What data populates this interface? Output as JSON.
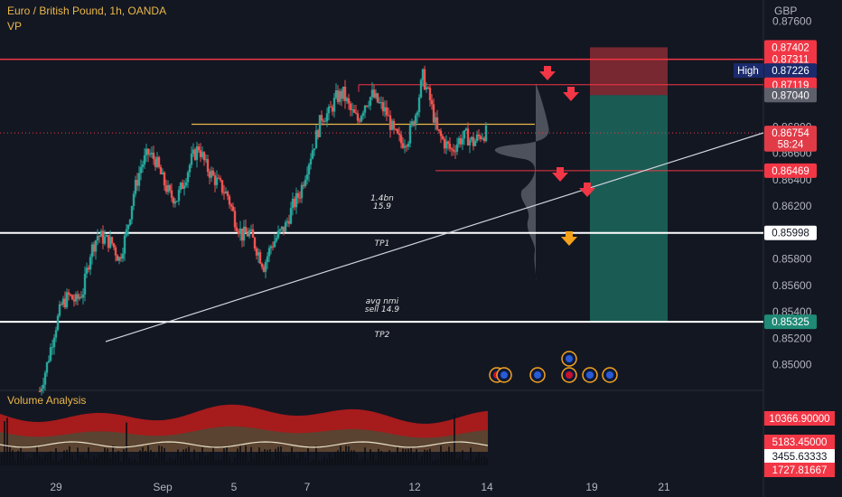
{
  "header": {
    "symbol_title": "Euro / British Pound, 1h, OANDA",
    "indicator": "VP",
    "currency": "GBP"
  },
  "colors": {
    "background": "#131722",
    "up": "#26a69a",
    "down": "#ef5350",
    "level_red": "#f23645",
    "level_white": "#ffffff",
    "current_price": "#e23b48",
    "take_profit_zone": "#1f8a76",
    "stop_zone": "#8a2c33",
    "accent_yellow": "#e9b74a",
    "arrow_red": "#f23645",
    "arrow_orange": "#f5a21b"
  },
  "chart_data": {
    "type": "candlestick",
    "price_axis": {
      "ticks": [
        "0.87600",
        "0.86800",
        "0.86600",
        "0.86400",
        "0.86200",
        "0.85800",
        "0.85600",
        "0.85400",
        "0.85200",
        "0.85000"
      ],
      "range": [
        0.8482,
        0.8776
      ]
    },
    "time_axis": {
      "ticks": [
        "29",
        "Sep",
        "5",
        "7",
        "12",
        "14",
        "19",
        "21"
      ]
    },
    "series_trend": [
      0.848,
      0.85,
      0.8525,
      0.8545,
      0.8552,
      0.8548,
      0.8556,
      0.8585,
      0.8598,
      0.8595,
      0.8592,
      0.858,
      0.86,
      0.863,
      0.865,
      0.866,
      0.8655,
      0.864,
      0.8628,
      0.8626,
      0.864,
      0.8655,
      0.8665,
      0.865,
      0.8642,
      0.8635,
      0.8628,
      0.861,
      0.8598,
      0.86,
      0.8588,
      0.8575,
      0.859,
      0.8598,
      0.8605,
      0.862,
      0.863,
      0.865,
      0.8668,
      0.8688,
      0.869,
      0.8702,
      0.8705,
      0.8692,
      0.8685,
      0.8698,
      0.8704,
      0.8697,
      0.869,
      0.8675,
      0.8668,
      0.8672,
      0.869,
      0.8718,
      0.87,
      0.8676,
      0.8668,
      0.8662,
      0.867,
      0.8673,
      0.8668,
      0.8674,
      0.8676
    ],
    "price_tags": [
      {
        "label": "0.87402",
        "price": 0.87402,
        "kind": "red"
      },
      {
        "label": "0.87311",
        "price": 0.87311,
        "kind": "red"
      },
      {
        "label": "0.87226",
        "price": 0.87226,
        "kind": "navy"
      },
      {
        "label": "0.87119",
        "price": 0.87119,
        "kind": "red"
      },
      {
        "label": "0.87040",
        "price": 0.8704,
        "kind": "gray"
      },
      {
        "label": "0.86754",
        "price": 0.86754,
        "kind": "current"
      },
      {
        "label": "58:24",
        "price": 0.86668,
        "kind": "current"
      },
      {
        "label": "0.86469",
        "price": 0.86469,
        "kind": "red"
      },
      {
        "label": "0.85998",
        "price": 0.85998,
        "kind": "white"
      },
      {
        "label": "0.85325",
        "price": 0.85325,
        "kind": "green"
      }
    ],
    "high_label": "High",
    "levels": [
      {
        "price": 0.87311,
        "style": "red-solid"
      },
      {
        "price": 0.87119,
        "style": "red-thin"
      },
      {
        "price": 0.86754,
        "style": "red-dotted"
      },
      {
        "price": 0.86469,
        "style": "red-thin"
      },
      {
        "price": 0.85998,
        "style": "white"
      },
      {
        "price": 0.85325,
        "style": "white"
      }
    ],
    "annotations": [
      {
        "lines": [
          "1.4bn",
          "15.9"
        ],
        "price": 0.8618
      },
      {
        "lines": [
          "TP1"
        ],
        "price": 0.859
      },
      {
        "lines": [
          "avg nmi",
          "sell 14.9"
        ],
        "price": 0.854
      },
      {
        "lines": [
          "TP2"
        ],
        "price": 0.8521
      }
    ],
    "position": {
      "entry": 0.8704,
      "stop": 0.87402,
      "target": 0.85325
    }
  },
  "volume_panel": {
    "title": "Volume Analysis",
    "values": [
      "10366.90000",
      "5183.45000",
      "3455.63333",
      "1727.81667"
    ]
  }
}
